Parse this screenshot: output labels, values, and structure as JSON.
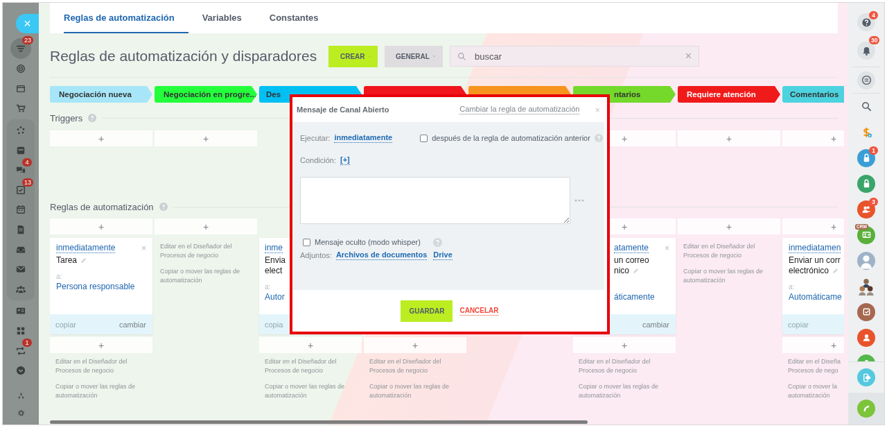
{
  "left_sidebar": {
    "close": "×",
    "items": [
      {
        "kind": "filter",
        "badge": "23",
        "selected": true
      },
      {
        "kind": "target",
        "selected": false
      },
      {
        "kind": "window",
        "selected": false
      },
      {
        "kind": "cart",
        "selected": false
      }
    ],
    "group": [
      {
        "kind": "flow",
        "selected": false
      },
      {
        "kind": "panel",
        "selected": false
      },
      {
        "kind": "chat",
        "badge": "4",
        "selected": false
      },
      {
        "kind": "tasks",
        "badge": "13",
        "selected": false
      },
      {
        "kind": "calendar",
        "selected": false
      },
      {
        "kind": "document",
        "selected": false
      },
      {
        "kind": "inbox",
        "selected": false
      },
      {
        "kind": "mail",
        "selected": false
      },
      {
        "kind": "people",
        "selected": false
      }
    ],
    "more": [
      {
        "kind": "contact",
        "selected": false
      },
      {
        "kind": "grid",
        "selected": false
      },
      {
        "kind": "sync",
        "badge": "1",
        "selected": false
      },
      {
        "kind": "more",
        "selected": false
      }
    ],
    "footer": [
      {
        "kind": "nodes",
        "selected": false
      },
      {
        "kind": "gear",
        "selected": false
      }
    ]
  },
  "tabs": [
    {
      "label": "Reglas de automatización",
      "selected": true
    },
    {
      "label": "Variables",
      "selected": false
    },
    {
      "label": "Constantes",
      "selected": false
    }
  ],
  "title": "Reglas de automatización y disparadores",
  "create_button": "CREAR",
  "general_button": "GENERAL",
  "search": {
    "placeholder": "buscar",
    "clear": "×"
  },
  "stages": [
    {
      "label": "Negociación nueva",
      "color": "#a6e6f8"
    },
    {
      "label": "Negociación en progre...",
      "color": "#24ff3c"
    },
    {
      "label": "Des",
      "color": "#00bff3"
    },
    {
      "color": "#f0161c"
    },
    {
      "color": "#f7941d"
    },
    {
      "label": "ntarios",
      "color": "#74d92a"
    },
    {
      "label": "Requiere atención",
      "color": "#f01a1a"
    },
    {
      "label": "Comentarios",
      "color": "#4dd3e0"
    }
  ],
  "triggers": {
    "heading": "Triggers",
    "columns": [
      {
        "kind": "add",
        "label": "+"
      },
      {
        "kind": "add",
        "label": "+"
      },
      {
        "kind": "covered"
      },
      {
        "kind": "covered"
      },
      {
        "kind": "covered"
      },
      {
        "kind": "add",
        "label": "+"
      },
      {
        "kind": "add",
        "label": "+"
      },
      {
        "kind": "add",
        "label": "+"
      }
    ]
  },
  "rules": {
    "heading": "Reglas de automatización",
    "columns": [
      {
        "kind": "open",
        "add": "+",
        "card": {
          "delay": "inmediatamente",
          "close": "×",
          "title": [
            "Tarea"
          ],
          "to_label": "a:",
          "to_value": "Persona responsable",
          "copy": "copiar",
          "change": "cambiar"
        },
        "add_below": "+",
        "help": [
          "Editar en el Diseñador del\nProcesos de negocio",
          "Copiar o mover las reglas de\nautomatización"
        ]
      },
      {
        "kind": "open",
        "add": "+",
        "help": [
          "Editar en el Diseñador del\nProcesos de negocio",
          "Copiar o mover las reglas de\nautomatización"
        ]
      },
      {
        "kind": "open",
        "card": {
          "delay": "inme",
          "title": [
            "Envia",
            "elect"
          ],
          "to_label": "a:",
          "to_value": "Autor",
          "copy": "copia"
        },
        "add_below": "+",
        "help": [
          "Editar en el Diseñador del\nProcesos de negocio",
          "Copiar o mover las reglas de\nautomatización"
        ]
      },
      {
        "kind": "open",
        "add_below": "+",
        "help": [
          "Editar en el Diseñador del\nProcesos de negocio",
          "Copiar o mover las reglas de\nautomatización"
        ]
      },
      {
        "kind": "covered"
      },
      {
        "kind": "open",
        "add": "+",
        "card": {
          "delay": "atamente",
          "close": "×",
          "title": [
            "un correo",
            "nico"
          ],
          "to_value": "áticamente",
          "change": "cambiar"
        },
        "add_below": "+",
        "help": [
          "Editar en el Diseñador del\nProcesos de negocio",
          "Copiar o mover las reglas de\nautomatización"
        ]
      },
      {
        "kind": "open",
        "add": "+",
        "help": [
          "Editar en el Diseñador del\nProcesos de negocio",
          "Copiar o mover las reglas de\nautomatización"
        ]
      },
      {
        "kind": "open",
        "add": "+",
        "card": {
          "delay": "inmediatamen",
          "title": [
            "Enviar un corr",
            "electrónico"
          ],
          "to_label": "a:",
          "to_value": "Automáticame",
          "copy": "copiar"
        },
        "add_below": "+",
        "help": [
          "Editar en el Diseña\nProcesos de nego",
          "Copiar o mover la\nautomatización"
        ]
      }
    ]
  },
  "dialog": {
    "title": "Mensaje de Canal Abierto",
    "change_rule": "Cambiar la regla de automatización",
    "close": "×",
    "run_label": "Ejecutar:",
    "run_value": "inmediatamente",
    "after_previous": {
      "label": "después de la regla de automatización anterior",
      "checked": false
    },
    "condition_label": "Condición:",
    "condition_add": "[+]",
    "whisper": {
      "label": "Mensaje oculto (modo whisper)",
      "checked": false
    },
    "attachments_label": "Adjuntos:",
    "attachments": [
      "Archivos de documentos",
      "Drive"
    ],
    "save": "GUARDAR",
    "cancel": "CANCELAR"
  },
  "right_sidebar": {
    "items": [
      {
        "kind": "help",
        "badge": "4"
      },
      {
        "kind": "bell",
        "badge": "30"
      },
      {
        "kind": "chat"
      },
      {
        "kind": "search"
      },
      {
        "kind": "dollar"
      },
      {
        "kind": "lock",
        "color": "#3b9fd6",
        "badge": "1"
      },
      {
        "kind": "lock",
        "color": "#3aa56a"
      },
      {
        "kind": "people",
        "color": "#e9532b",
        "badge": "3"
      },
      {
        "kind": "crm",
        "color": "#5aaf3a",
        "label": "CRM"
      },
      {
        "kind": "avatar"
      },
      {
        "kind": "group"
      },
      {
        "kind": "task",
        "color": "#a6684f"
      },
      {
        "kind": "person",
        "color": "#e9532b"
      },
      {
        "kind": "person",
        "color": "#55b84a"
      }
    ],
    "bottom": [
      {
        "kind": "cloud",
        "color": "#55c8e0"
      },
      {
        "kind": "call",
        "color": "#7cc43a"
      }
    ]
  }
}
